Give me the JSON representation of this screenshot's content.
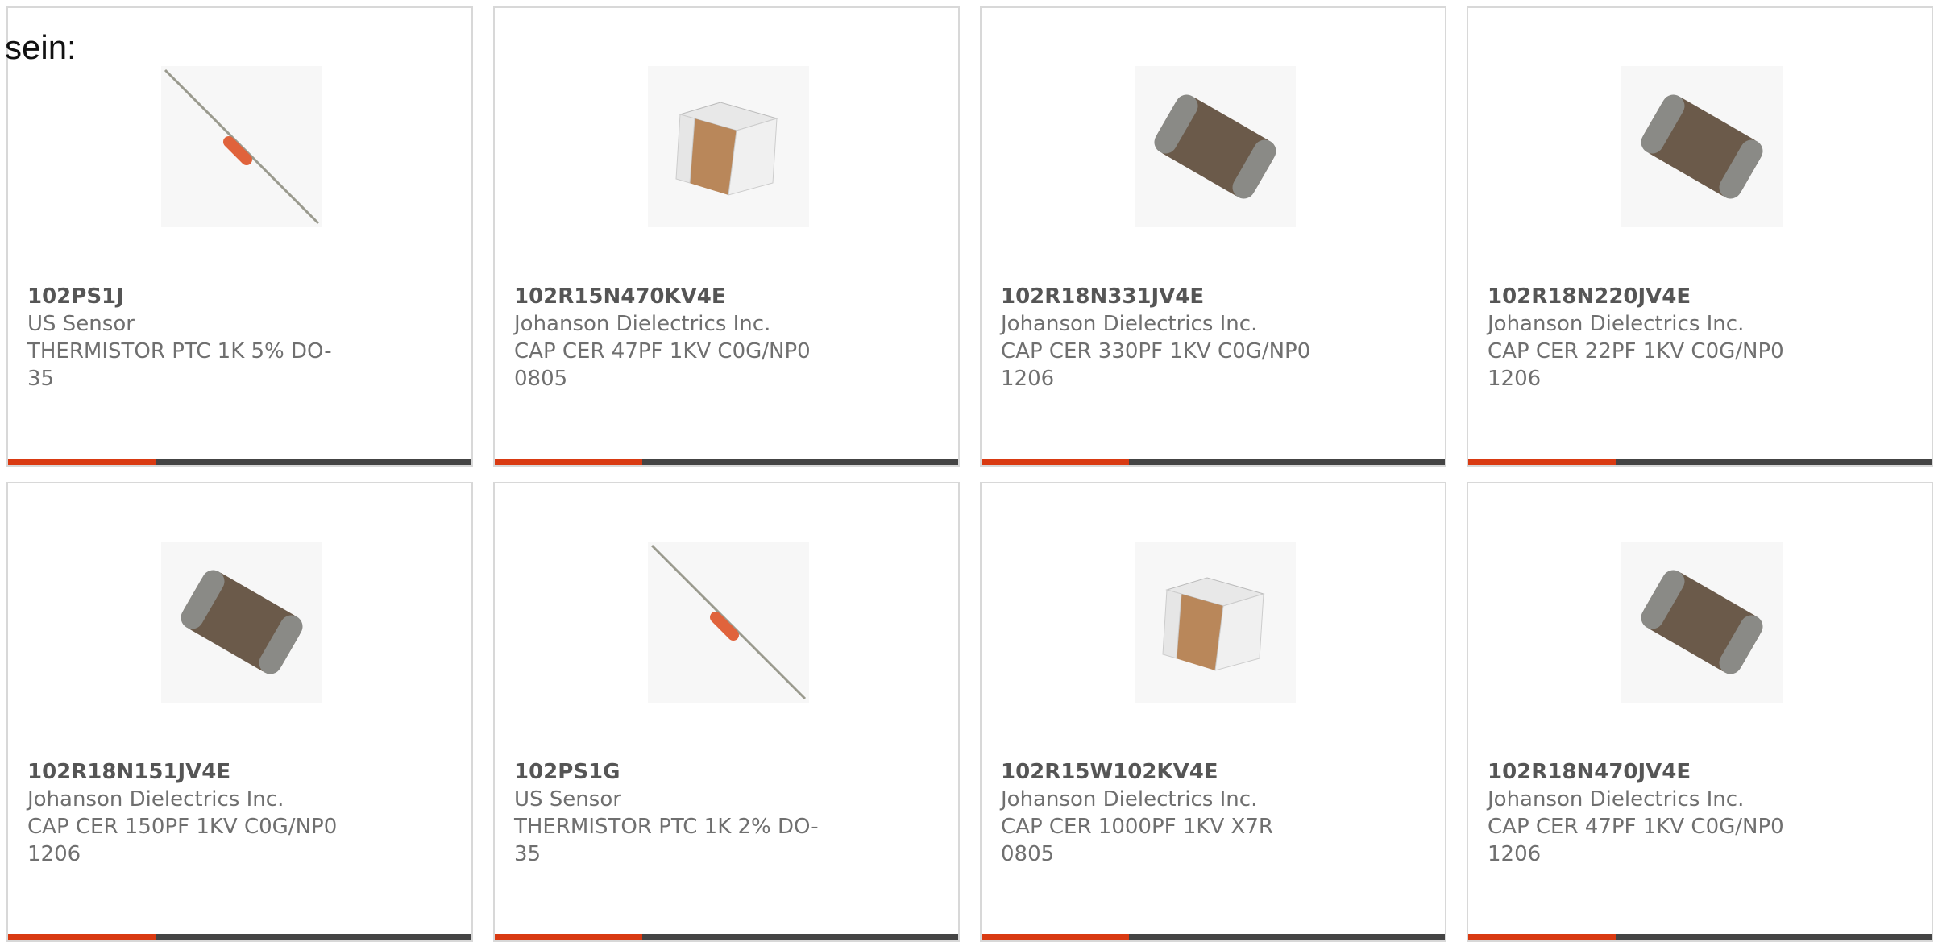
{
  "intro_text": "sein:",
  "accent_color": "#d93a12",
  "bar_color": "#444444",
  "products": [
    {
      "part": "102PS1J",
      "manufacturer": "US Sensor",
      "description": "THERMISTOR PTC 1K 5% DO-35",
      "image": "thermistor-axial"
    },
    {
      "part": "102R15N470KV4E",
      "manufacturer": "Johanson Dielectrics Inc.",
      "description": "CAP CER 47PF 1KV C0G/NP0 0805",
      "image": "capacitor-tan"
    },
    {
      "part": "102R18N331JV4E",
      "manufacturer": "Johanson Dielectrics Inc.",
      "description": "CAP CER 330PF 1KV C0G/NP0 1206",
      "image": "capacitor-dark"
    },
    {
      "part": "102R18N220JV4E",
      "manufacturer": "Johanson Dielectrics Inc.",
      "description": "CAP CER 22PF 1KV C0G/NP0 1206",
      "image": "capacitor-dark"
    },
    {
      "part": "102R18N151JV4E",
      "manufacturer": "Johanson Dielectrics Inc.",
      "description": "CAP CER 150PF 1KV C0G/NP0 1206",
      "image": "capacitor-dark"
    },
    {
      "part": "102PS1G",
      "manufacturer": "US Sensor",
      "description": "THERMISTOR PTC 1K 2% DO-35",
      "image": "thermistor-axial"
    },
    {
      "part": "102R15W102KV4E",
      "manufacturer": "Johanson Dielectrics Inc.",
      "description": "CAP CER 1000PF 1KV X7R 0805",
      "image": "capacitor-tan"
    },
    {
      "part": "102R18N470JV4E",
      "manufacturer": "Johanson Dielectrics Inc.",
      "description": "CAP CER 47PF 1KV C0G/NP0 1206",
      "image": "capacitor-dark"
    }
  ]
}
